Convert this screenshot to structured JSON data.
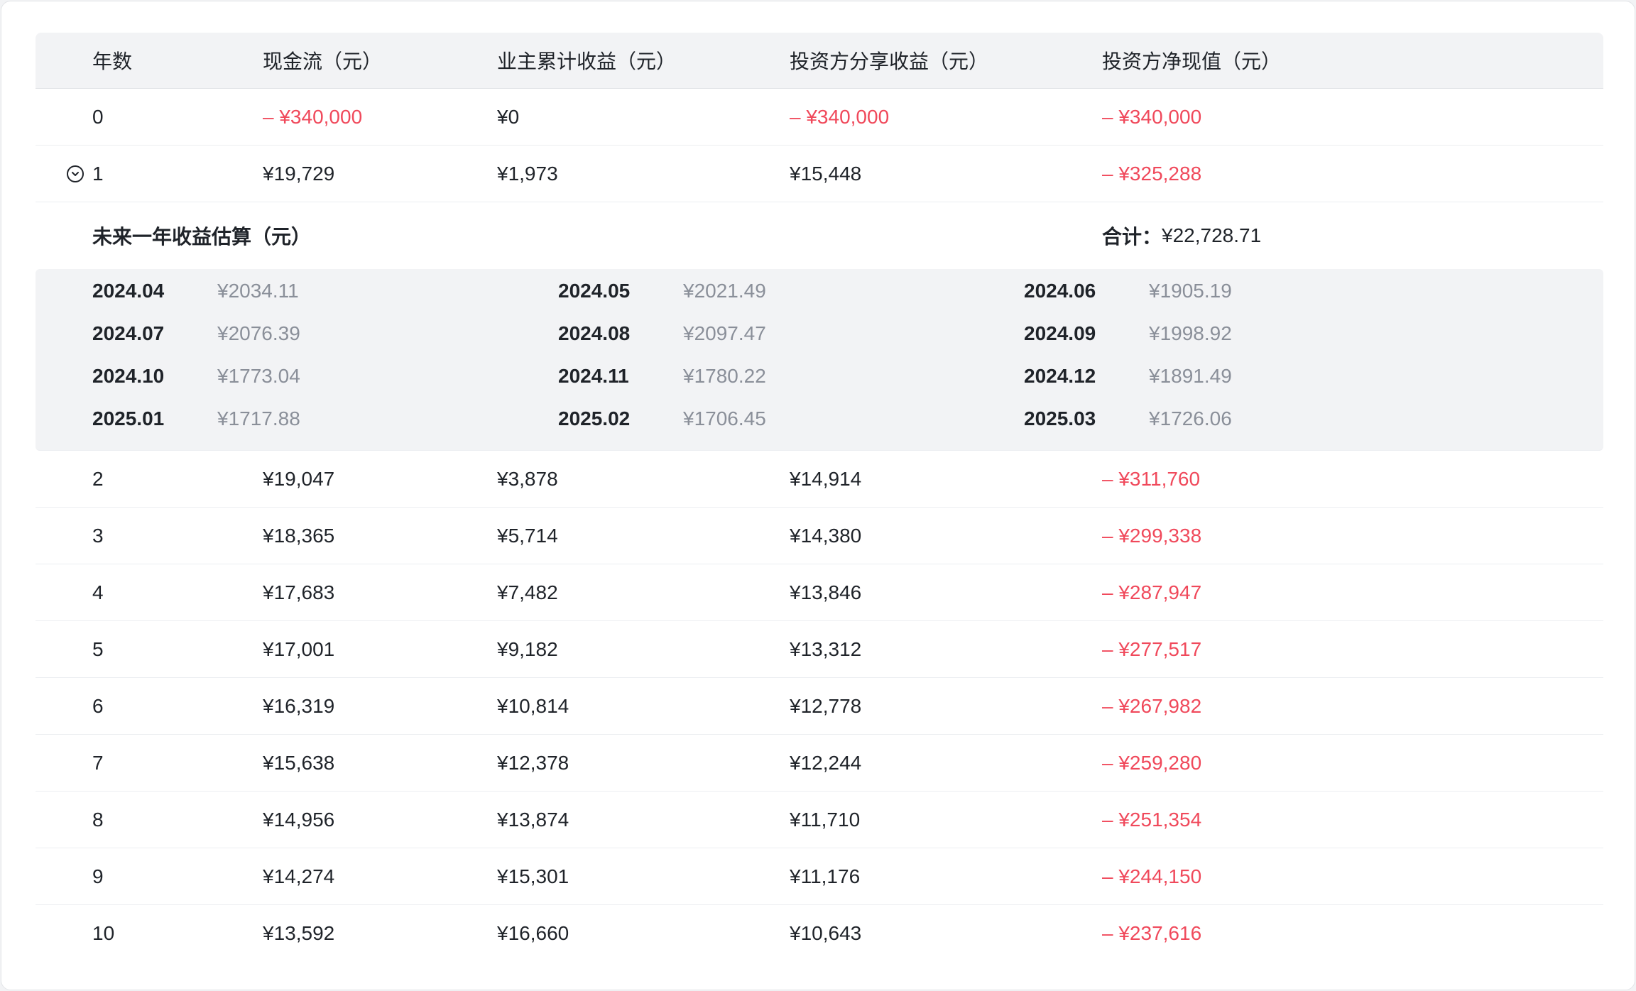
{
  "headers": [
    "年数",
    "现金流（元）",
    "业主累计收益（元）",
    "投资方分享收益（元）",
    "投资方净现值（元）"
  ],
  "rows_top": [
    {
      "year": "0",
      "cash": "– ¥340,000",
      "owner": "¥0",
      "investor": "– ¥340,000",
      "npv": "– ¥340,000",
      "cash_neg": true,
      "investor_neg": true
    },
    {
      "year": "1",
      "cash": "¥19,729",
      "owner": "¥1,973",
      "investor": "¥15,448",
      "npv": "– ¥325,288",
      "cash_neg": false,
      "investor_neg": false
    }
  ],
  "forecast": {
    "title": "未来一年收益估算（元）",
    "total_label": "合计：",
    "total_value": "¥22,728.71",
    "months": [
      {
        "month": "2024.04",
        "value": "¥2034.11"
      },
      {
        "month": "2024.05",
        "value": "¥2021.49"
      },
      {
        "month": "2024.06",
        "value": "¥1905.19"
      },
      {
        "month": "2024.07",
        "value": "¥2076.39"
      },
      {
        "month": "2024.08",
        "value": "¥2097.47"
      },
      {
        "month": "2024.09",
        "value": "¥1998.92"
      },
      {
        "month": "2024.10",
        "value": "¥1773.04"
      },
      {
        "month": "2024.11",
        "value": "¥1780.22"
      },
      {
        "month": "2024.12",
        "value": "¥1891.49"
      },
      {
        "month": "2025.01",
        "value": "¥1717.88"
      },
      {
        "month": "2025.02",
        "value": "¥1706.45"
      },
      {
        "month": "2025.03",
        "value": "¥1726.06"
      }
    ]
  },
  "rows_bottom": [
    {
      "year": "2",
      "cash": "¥19,047",
      "owner": "¥3,878",
      "investor": "¥14,914",
      "npv": "– ¥311,760"
    },
    {
      "year": "3",
      "cash": "¥18,365",
      "owner": "¥5,714",
      "investor": "¥14,380",
      "npv": "– ¥299,338"
    },
    {
      "year": "4",
      "cash": "¥17,683",
      "owner": "¥7,482",
      "investor": "¥13,846",
      "npv": "– ¥287,947"
    },
    {
      "year": "5",
      "cash": "¥17,001",
      "owner": "¥9,182",
      "investor": "¥13,312",
      "npv": "– ¥277,517"
    },
    {
      "year": "6",
      "cash": "¥16,319",
      "owner": "¥10,814",
      "investor": "¥12,778",
      "npv": "– ¥267,982"
    },
    {
      "year": "7",
      "cash": "¥15,638",
      "owner": "¥12,378",
      "investor": "¥12,244",
      "npv": "– ¥259,280"
    },
    {
      "year": "8",
      "cash": "¥14,956",
      "owner": "¥13,874",
      "investor": "¥11,710",
      "npv": "– ¥251,354"
    },
    {
      "year": "9",
      "cash": "¥14,274",
      "owner": "¥15,301",
      "investor": "¥11,176",
      "npv": "– ¥244,150"
    },
    {
      "year": "10",
      "cash": "¥13,592",
      "owner": "¥16,660",
      "investor": "¥10,643",
      "npv": "– ¥237,616"
    }
  ],
  "icons": {
    "expand": "chevron-down-circle-icon"
  },
  "colors": {
    "negative": "#f0495b",
    "header_bg": "#f2f3f5",
    "muted": "#8a8f99"
  }
}
